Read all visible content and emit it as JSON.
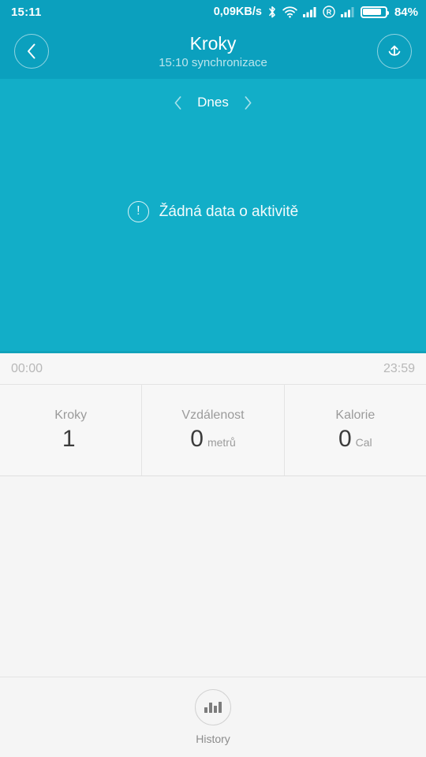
{
  "status_bar": {
    "clock": "15:11",
    "network_speed": "0,09KB/s",
    "bluetooth_icon": "bluetooth-icon",
    "wifi_icon": "wifi-icon",
    "signal_icon": "cellular-signal-icon",
    "roaming_icon": "roaming-icon",
    "signal2_icon": "cellular-signal-2-icon",
    "battery_icon": "battery-icon",
    "battery_percent": "84%",
    "battery_level": 84
  },
  "header": {
    "back_icon": "chevron-left-icon",
    "title": "Kroky",
    "subtitle": "15:10 synchronizace",
    "sync_icon": "sync-upload-icon"
  },
  "chart_panel": {
    "day_nav": {
      "prev_icon": "chevron-left-icon",
      "label": "Dnes",
      "next_icon": "chevron-right-icon"
    },
    "empty_state": {
      "icon": "exclamation-circle-icon",
      "icon_glyph": "!",
      "message": "Žádná data o aktivitě"
    },
    "background_color": "#12AEC8"
  },
  "time_axis": {
    "start": "00:00",
    "end": "23:59"
  },
  "stats": [
    {
      "label": "Kroky",
      "value": "1",
      "unit": ""
    },
    {
      "label": "Vzdálenost",
      "value": "0",
      "unit": "metrů"
    },
    {
      "label": "Kalorie",
      "value": "0",
      "unit": "Cal"
    }
  ],
  "bottom_bar": {
    "history_icon": "bar-chart-icon",
    "history_label": "History"
  },
  "colors": {
    "header": "#0BA0BE",
    "chart": "#12AEC8",
    "page_bg": "#F5F5F5",
    "panel_bg": "#F7F7F7",
    "text_dark": "#3C3C3C",
    "text_muted": "#9B9B9B"
  },
  "chart_data": {
    "type": "bar",
    "title": "Kroky",
    "xlabel": "",
    "ylabel": "",
    "categories": [],
    "values": [],
    "x_axis_ticks": [
      "00:00",
      "23:59"
    ],
    "grid": false,
    "legend": "none",
    "annotation": "Žádná data o aktivitě"
  }
}
